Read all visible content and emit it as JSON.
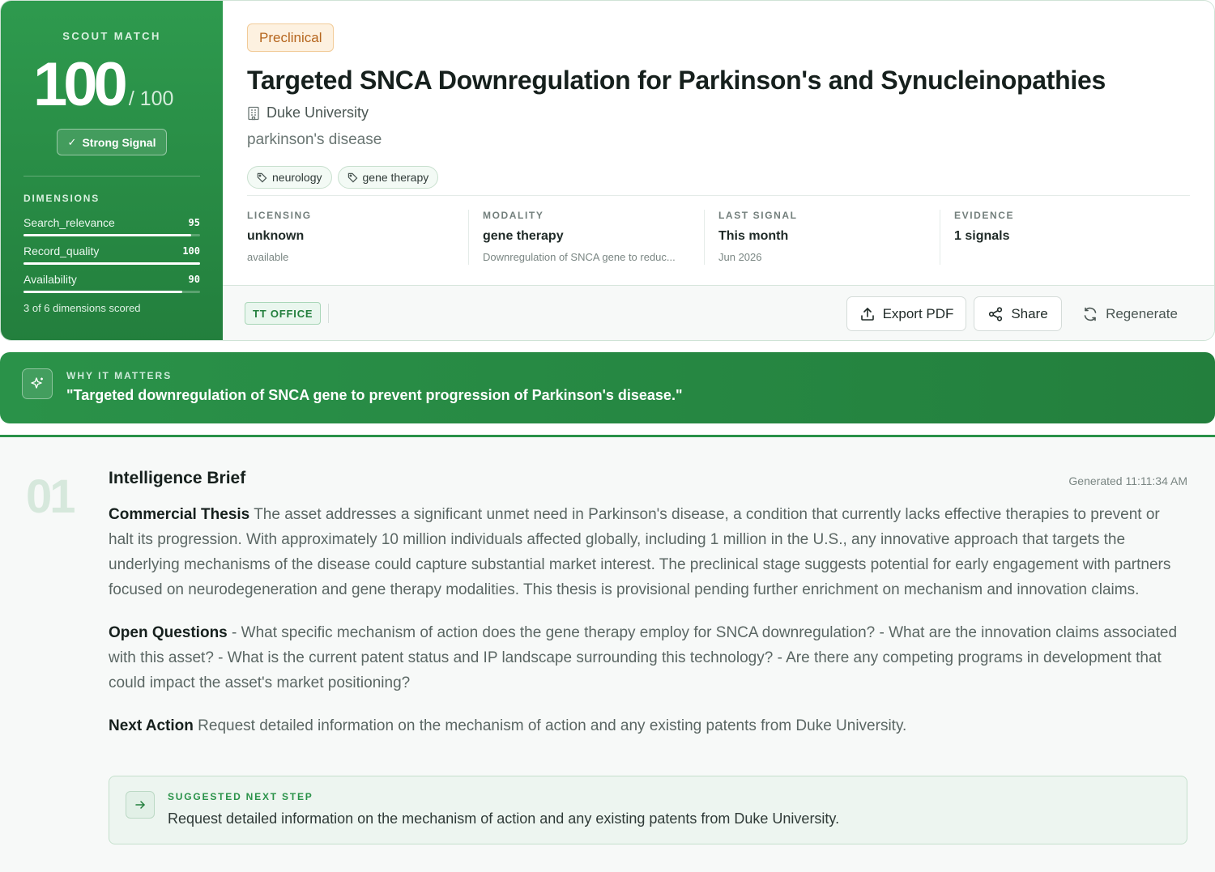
{
  "score": {
    "label": "SCOUT MATCH",
    "value": "100",
    "max": "/ 100",
    "signal_label": "Strong Signal",
    "dimensions_label": "DIMENSIONS",
    "dimensions": [
      {
        "name": "Search_relevance",
        "value": "95",
        "fraction": 0.95
      },
      {
        "name": "Record_quality",
        "value": "100",
        "fraction": 1.0
      },
      {
        "name": "Availability",
        "value": "90",
        "fraction": 0.9
      }
    ],
    "dimensions_footer": "3 of 6 dimensions scored"
  },
  "asset": {
    "stage": "Preclinical",
    "title": "Targeted SNCA Downregulation for Parkinson's and Synucleinopathies",
    "institution": "Duke University",
    "disease": "parkinson's disease",
    "tags": [
      "neurology",
      "gene therapy"
    ]
  },
  "metrics": [
    {
      "label": "LICENSING",
      "value": "unknown",
      "sub": "available"
    },
    {
      "label": "MODALITY",
      "value": "gene therapy",
      "sub": "Downregulation of SNCA gene to reduc..."
    },
    {
      "label": "LAST SIGNAL",
      "value": "This month",
      "sub": "Jun 2026"
    },
    {
      "label": "EVIDENCE",
      "value": "1 signals",
      "sub": ""
    }
  ],
  "actions": {
    "office_chip": "TT OFFICE",
    "export_label": "Export PDF",
    "share_label": "Share",
    "regenerate_label": "Regenerate"
  },
  "why": {
    "label": "WHY IT MATTERS",
    "quote": "\"Targeted downregulation of SNCA gene to prevent progression of Parkinson's disease.\""
  },
  "brief": {
    "number": "01",
    "title": "Intelligence Brief",
    "generated": "Generated 11:11:34 AM",
    "thesis_lead": "Commercial Thesis",
    "thesis": "The asset addresses a significant unmet need in Parkinson's disease, a condition that currently lacks effective therapies to prevent or halt its progression. With approximately 10 million individuals affected globally, including 1 million in the U.S., any innovative approach that targets the underlying mechanisms of the disease could capture substantial market interest. The preclinical stage suggests potential for early engagement with partners focused on neurodegeneration and gene therapy modalities. This thesis is provisional pending further enrichment on mechanism and innovation claims.",
    "questions_lead": "Open Questions",
    "questions": "- What specific mechanism of action does the gene therapy employ for SNCA downregulation? - What are the innovation claims associated with this asset? - What is the current patent status and IP landscape surrounding this technology? - Are there any competing programs in development that could impact the asset's market positioning?",
    "next_lead": "Next Action",
    "next": "Request detailed information on the mechanism of action and any existing patents from Duke University.",
    "suggested_label": "SUGGESTED NEXT STEP",
    "suggested_text": "Request detailed information on the mechanism of action and any existing patents from Duke University."
  },
  "colors": {
    "brand_green": "#2a9249",
    "stage_orange": "#b5651d"
  }
}
